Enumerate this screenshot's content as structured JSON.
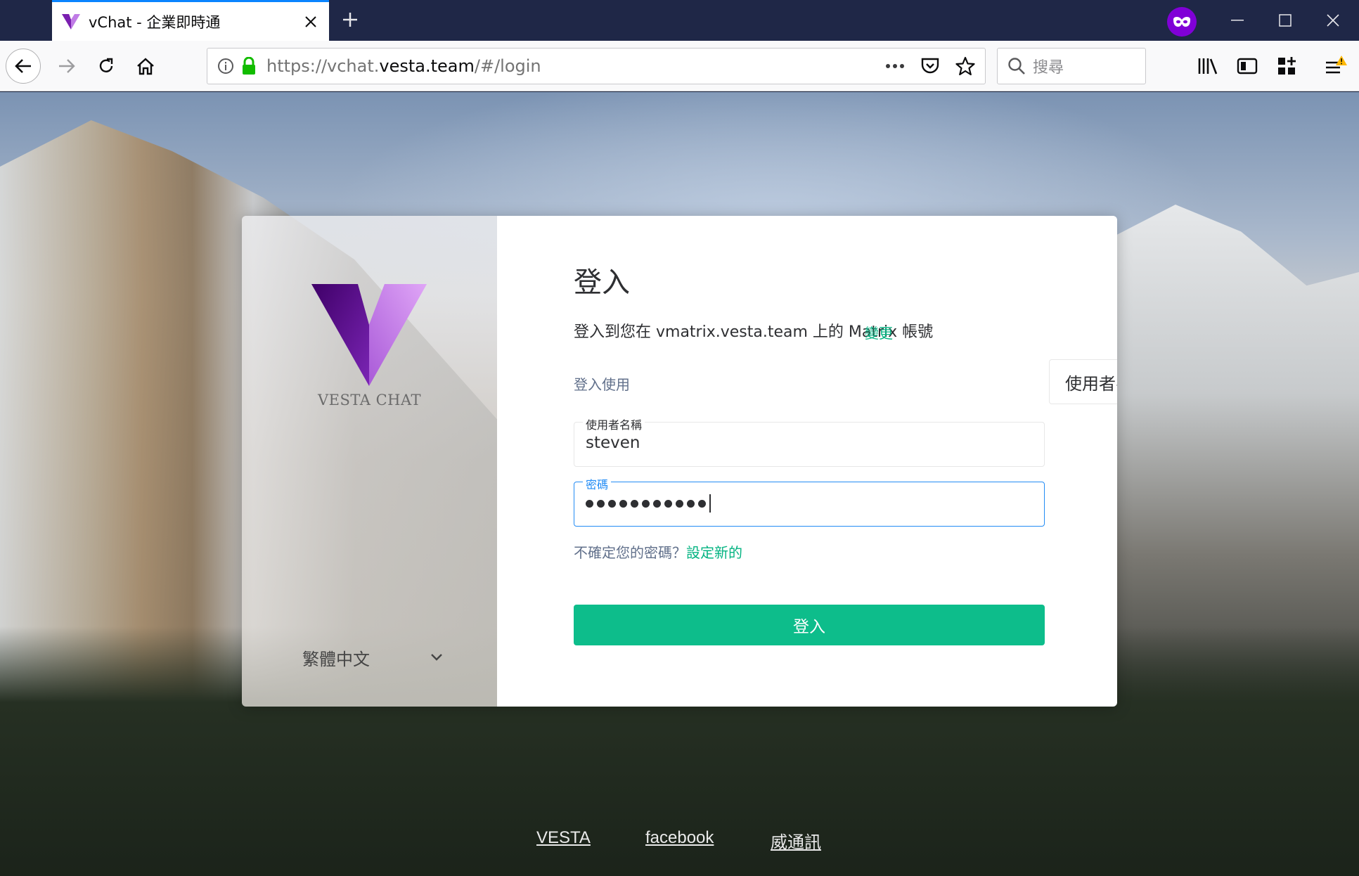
{
  "browser": {
    "tab_title": "vChat - 企業即時通",
    "url_scheme": "https://vchat.",
    "url_host": "vesta.team",
    "url_path": "/#/login",
    "search_placeholder": "搜尋"
  },
  "brand": {
    "name": "VESTA CHAT",
    "logo_colors": {
      "dark": "#5b0f8c",
      "light": "#d69cf0"
    }
  },
  "language": {
    "selected": "繁體中文"
  },
  "login": {
    "title": "登入",
    "subtitle": "登入到您在 vmatrix.vesta.team 上的 Matrix 帳號",
    "change_link": "變更",
    "login_with_label": "登入使用",
    "login_with_value": "使用者名稱",
    "username_label": "使用者名稱",
    "username_value": "steven",
    "password_label": "密碼",
    "password_length": 11,
    "forgot_text": "不確定您的密碼？",
    "forgot_link": "設定新的",
    "submit_label": "登入"
  },
  "footer": {
    "links": [
      "VESTA",
      "facebook",
      "威通訊"
    ]
  },
  "colors": {
    "accent": "#0dbd8b",
    "link": "#03b381",
    "focus": "#238cf5",
    "titlebar": "#1f2747",
    "private_badge": "#8000d7"
  }
}
